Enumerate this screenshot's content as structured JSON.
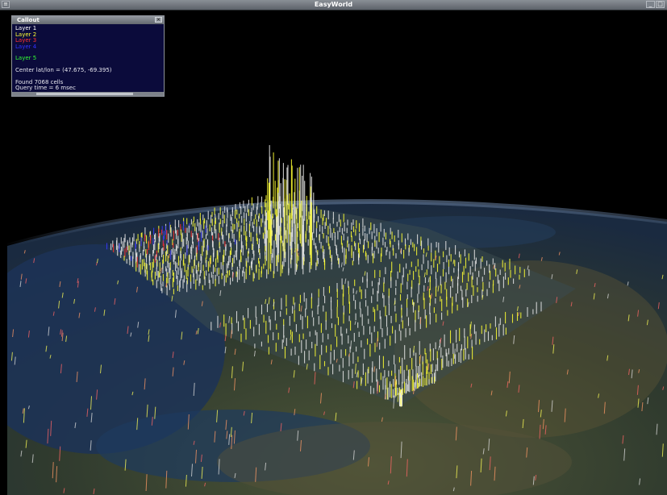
{
  "window": {
    "title": "EasyWorld",
    "menu_glyph": "≡",
    "min_glyph": "_",
    "max_glyph": "□"
  },
  "callout": {
    "title": "Callout",
    "close_glyph": "×",
    "layers": [
      {
        "label": "Layer 1",
        "color": "#ffffff"
      },
      {
        "label": "Layer 2",
        "color": "#ffff33"
      },
      {
        "label": "Layer 3",
        "color": "#ff3333"
      },
      {
        "label": "Layer 4",
        "color": "#3333ff"
      },
      {
        "label": "Layer 5",
        "color": "#33ff33"
      }
    ],
    "center_text": "Center lat/lon = (47.675, -69.395)",
    "found_text": "Found 7068 cells",
    "query_text": "Query time = 6 msec"
  },
  "scene": {
    "globe_land": "#3d4734",
    "globe_water": "#1b2f55",
    "glyph_colors": [
      "#ffffff",
      "#ffff33",
      "#ff3333",
      "#3333ff"
    ]
  }
}
